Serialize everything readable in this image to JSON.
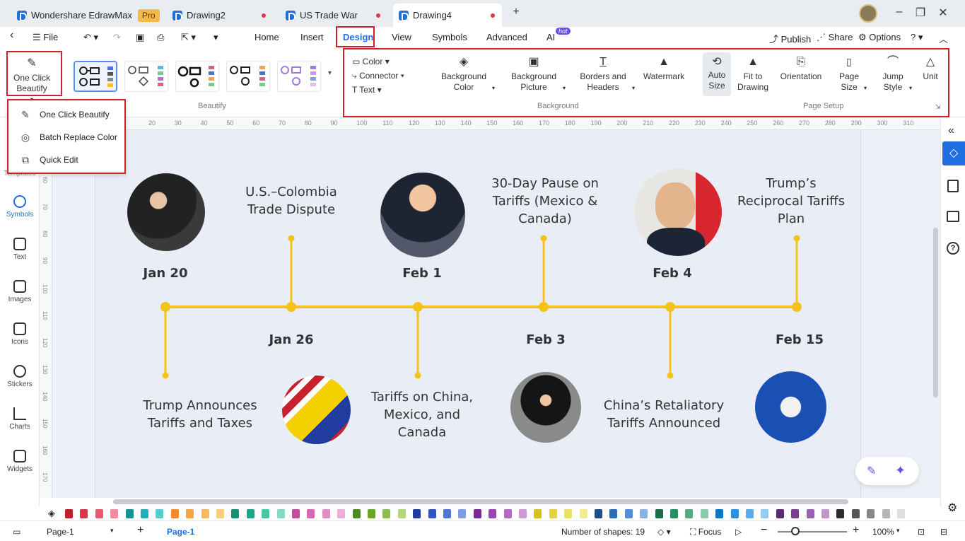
{
  "app": {
    "name": "Wondershare EdrawMax",
    "badge": "Pro"
  },
  "tabs": [
    {
      "label": "Drawing2"
    },
    {
      "label": "US Trade War"
    },
    {
      "label": "Drawing4"
    }
  ],
  "menu": {
    "file": "File",
    "items": [
      "Home",
      "Insert",
      "Design",
      "View",
      "Symbols",
      "Advanced",
      "AI"
    ],
    "ai_badge": "hot",
    "publish": "Publish",
    "share": "Share",
    "options": "Options"
  },
  "ribbon": {
    "one_click_beautify": "One Click Beautify",
    "beautify_group": "Beautify",
    "color": "Color",
    "connector": "Connector",
    "text": "Text",
    "background_color": "Background Color",
    "background_picture": "Background Picture",
    "borders_headers": "Borders and Headers",
    "watermark": "Watermark",
    "background_group": "Background",
    "auto_size": "Auto Size",
    "fit_to_drawing": "Fit to Drawing",
    "orientation": "Orientation",
    "page_size": "Page Size",
    "jump_style": "Jump Style",
    "unit": "Unit",
    "page_setup_group": "Page Setup"
  },
  "dropdown": {
    "items": [
      "One Click Beautify",
      "Batch Replace Color",
      "Quick Edit"
    ]
  },
  "leftbar": {
    "templates_partial": "Templates",
    "items": [
      "Symbols",
      "Text",
      "Images",
      "Icons",
      "Stickers",
      "Charts",
      "Widgets"
    ]
  },
  "ruler": {
    "h_ticks": [
      "20",
      "30",
      "40",
      "50",
      "60",
      "70",
      "80",
      "90",
      "100",
      "110",
      "120",
      "130",
      "140",
      "150",
      "160",
      "170",
      "180",
      "190",
      "200",
      "210",
      "220",
      "230",
      "240",
      "250",
      "260",
      "270",
      "280",
      "290",
      "300",
      "310"
    ],
    "v_ticks": [
      "60",
      "70",
      "80",
      "90",
      "100",
      "110",
      "120",
      "130",
      "140",
      "150",
      "160",
      "170"
    ]
  },
  "timeline": {
    "top_dates": [
      "Jan 20",
      "Feb 1",
      "Feb 4"
    ],
    "top_events": [
      "U.S.–Colombia Trade Dispute",
      "30-Day Pause on Tariffs (Mexico & Canada)",
      "Trump’s Reciprocal Tariffs Plan"
    ],
    "bottom_dates": [
      "Jan 26",
      "Feb 3",
      "Feb 15"
    ],
    "bottom_events": [
      "Trump Announces Tariffs and Taxes",
      "Tariffs on China, Mexico, and Canada",
      "China’s Retaliatory Tariffs Announced"
    ],
    "line_color": "#f5c21b"
  },
  "status": {
    "page_selector": "Page-1",
    "page_tab": "Page-1",
    "shape_count": "Number of shapes: 19",
    "focus": "Focus",
    "zoom": "100%"
  },
  "swatches": [
    "#c0202a",
    "#d9374b",
    "#e8596c",
    "#f08aa0",
    "#17909a",
    "#1fb0b8",
    "#55cbd2",
    "#f08a2c",
    "#f5a43f",
    "#f7b95d",
    "#f9cd7e",
    "#138f72",
    "#1aa88a",
    "#4cc3a6",
    "#85d8c1",
    "#c84aa0",
    "#d56ab4",
    "#e08cc6",
    "#eaaed8",
    "#4e8a1e",
    "#6aa62a",
    "#8cc04a",
    "#b1d67c",
    "#1f3c9e",
    "#2f56c0",
    "#4f76d6",
    "#7e9de3",
    "#7a2a8f",
    "#9a46ae",
    "#b46ac4",
    "#cd97d8",
    "#d6c21e",
    "#e2d23e",
    "#ecdf6a",
    "#f3eb9a",
    "#1f4f8a",
    "#2c6bb5",
    "#5290d0",
    "#86b3e1",
    "#1d6d48",
    "#2a8f60",
    "#52ad80",
    "#8acaa8",
    "#0f76c4",
    "#2a92dc",
    "#5aaee6",
    "#92caf0",
    "#5c2a6e",
    "#7a3e90",
    "#9a62ae",
    "#c096cc",
    "#2b2b2b",
    "#555555",
    "#888888",
    "#b5b5b5",
    "#dddddd"
  ]
}
